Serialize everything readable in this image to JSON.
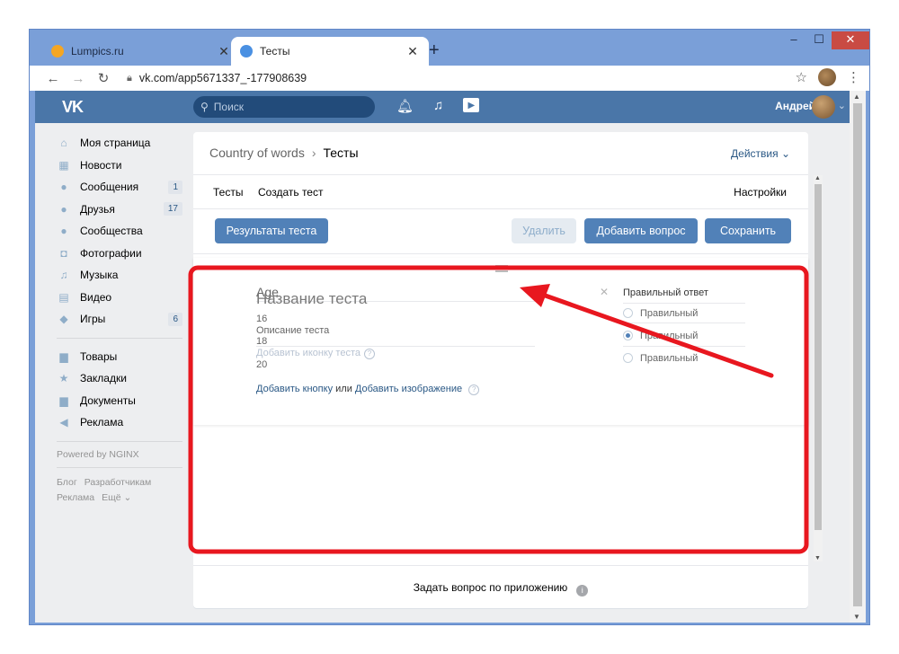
{
  "browser": {
    "tabs": [
      {
        "title": "Lumpics.ru",
        "active": false,
        "favicon_color": "#f5a623"
      },
      {
        "title": "Тесты",
        "active": true,
        "favicon_color": "#4a90e2"
      }
    ],
    "new_tab": "+",
    "url": "vk.com/app5671337_-177908639",
    "win": {
      "min": "–",
      "max": "☐",
      "close": "✕"
    }
  },
  "header": {
    "logo": "VK",
    "search_placeholder": "Поиск",
    "user_name": "Андрей"
  },
  "sidebar": {
    "items": [
      {
        "label": "Моя страница",
        "icon": "home-icon",
        "glyph": "⌂",
        "count": ""
      },
      {
        "label": "Новости",
        "icon": "news-icon",
        "glyph": "▦",
        "count": ""
      },
      {
        "label": "Сообщения",
        "icon": "messages-icon",
        "glyph": "●",
        "count": "1"
      },
      {
        "label": "Друзья",
        "icon": "friends-icon",
        "glyph": "●",
        "count": "17"
      },
      {
        "label": "Сообщества",
        "icon": "groups-icon",
        "glyph": "●",
        "count": ""
      },
      {
        "label": "Фотографии",
        "icon": "photo-icon",
        "glyph": "◘",
        "count": ""
      },
      {
        "label": "Музыка",
        "icon": "music-icon",
        "glyph": "♫",
        "count": ""
      },
      {
        "label": "Видео",
        "icon": "video-icon",
        "glyph": "▤",
        "count": ""
      },
      {
        "label": "Игры",
        "icon": "games-icon",
        "glyph": "◆",
        "count": "6"
      }
    ],
    "items2": [
      {
        "label": "Товары",
        "icon": "bag-icon",
        "glyph": "▆"
      },
      {
        "label": "Закладки",
        "icon": "star-icon",
        "glyph": "★"
      },
      {
        "label": "Документы",
        "icon": "document-icon",
        "glyph": "▆"
      },
      {
        "label": "Реклама",
        "icon": "ads-icon",
        "glyph": "◀"
      }
    ],
    "powered": "Powered by NGINX",
    "footer": [
      "Блог",
      "Разработчикам",
      "Реклама",
      "Ещё ⌄"
    ]
  },
  "card": {
    "breadcrumb": {
      "parent": "Country of words",
      "sep": "›",
      "current": "Тесты"
    },
    "actions": "Действия ⌄",
    "subtabs": {
      "tests": "Тесты",
      "create": "Создать тест",
      "settings": "Настройки"
    },
    "buttons": {
      "results": "Результаты теста",
      "delete": "Удалить",
      "add_question": "Добавить вопрос",
      "save": "Сохранить"
    },
    "editor": {
      "question": "Age",
      "title_placeholder": "Название теста",
      "a1": "16",
      "description": "Описание теста",
      "a2": "18",
      "add_icon": "Добавить иконку теста",
      "a3": "20",
      "add_button": "Добавить кнопку",
      "or": "или",
      "add_image": "Добавить изображение",
      "help": "?",
      "correct_header": "Правильный ответ",
      "correct": [
        "Правильный",
        "Правильный",
        "Правильный"
      ],
      "selected_index": 1
    },
    "footer": "Задать вопрос по приложению",
    "footer_info": "i"
  },
  "annotation": {
    "highlight_color": "#e8171f"
  }
}
